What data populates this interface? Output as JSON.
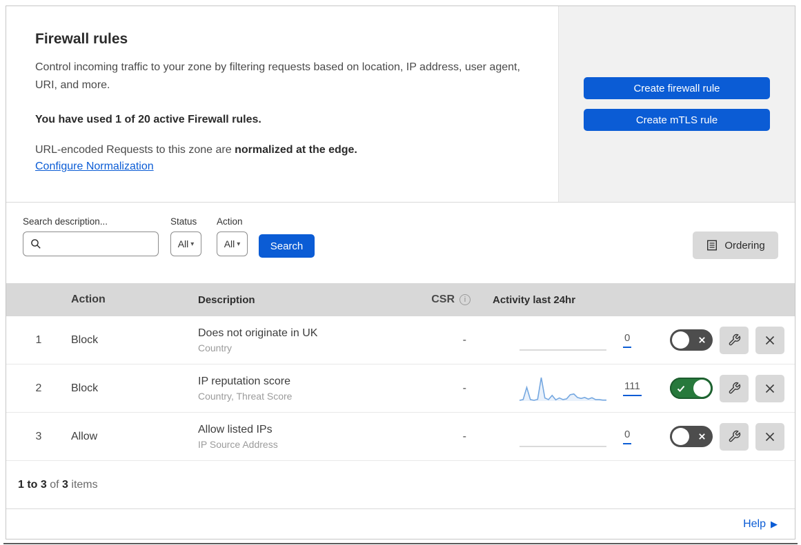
{
  "colors": {
    "accent_blue": "#0b5cd5",
    "toggle_on_green": "#27793c",
    "toggle_off_gray": "#4d4d4d",
    "spark_blue": "#74a7e0",
    "spark_flat_gray": "#c3c3c3",
    "panel_gray": "#f1f1f1",
    "table_header_gray": "#d8d8d8"
  },
  "icons": {
    "search": "magnifying-glass",
    "caret": "▾",
    "ordering": "list-document",
    "info": "i",
    "wrench": "wrench",
    "close": "x",
    "help_arrow": "▶"
  },
  "intro": {
    "title": "Firewall rules",
    "description": "Control incoming traffic to your zone by filtering requests based on location, IP address, user agent, URI, and more.",
    "usage": "You have used 1 of 20 active Firewall rules.",
    "normalization_text": "URL-encoded Requests to this zone are ",
    "normalization_bold": "normalized at the edge.",
    "configure_link": "Configure Normalization"
  },
  "panel": {
    "create_firewall": "Create firewall rule",
    "create_mtls": "Create mTLS rule"
  },
  "filters": {
    "search_label": "Search description...",
    "status_label": "Status",
    "status_value": "All",
    "action_label": "Action",
    "action_value": "All",
    "search_button": "Search",
    "ordering_button": "Ordering"
  },
  "table": {
    "headers": {
      "action": "Action",
      "description": "Description",
      "csr": "CSR",
      "activity": "Activity last 24hr"
    },
    "rows": [
      {
        "num": "1",
        "action": "Block",
        "title": "Does not originate in UK",
        "subtitle": "Country",
        "csr": "-",
        "count": "0",
        "enabled": false,
        "spark": []
      },
      {
        "num": "2",
        "action": "Block",
        "title": "IP reputation score",
        "subtitle": "Country, Threat Score",
        "csr": "-",
        "count": "111",
        "enabled": true,
        "spark": [
          3,
          6,
          58,
          6,
          3,
          7,
          100,
          13,
          6,
          24,
          5,
          13,
          6,
          9,
          27,
          30,
          15,
          11,
          15,
          8,
          14,
          6,
          6,
          4,
          4
        ]
      },
      {
        "num": "3",
        "action": "Allow",
        "title": "Allow listed IPs",
        "subtitle": "IP Source Address",
        "csr": "-",
        "count": "0",
        "enabled": false,
        "spark": []
      }
    ]
  },
  "footer": {
    "range": "1 to 3",
    "of": "of",
    "total": "3",
    "items": "items"
  },
  "help": {
    "label": "Help"
  }
}
